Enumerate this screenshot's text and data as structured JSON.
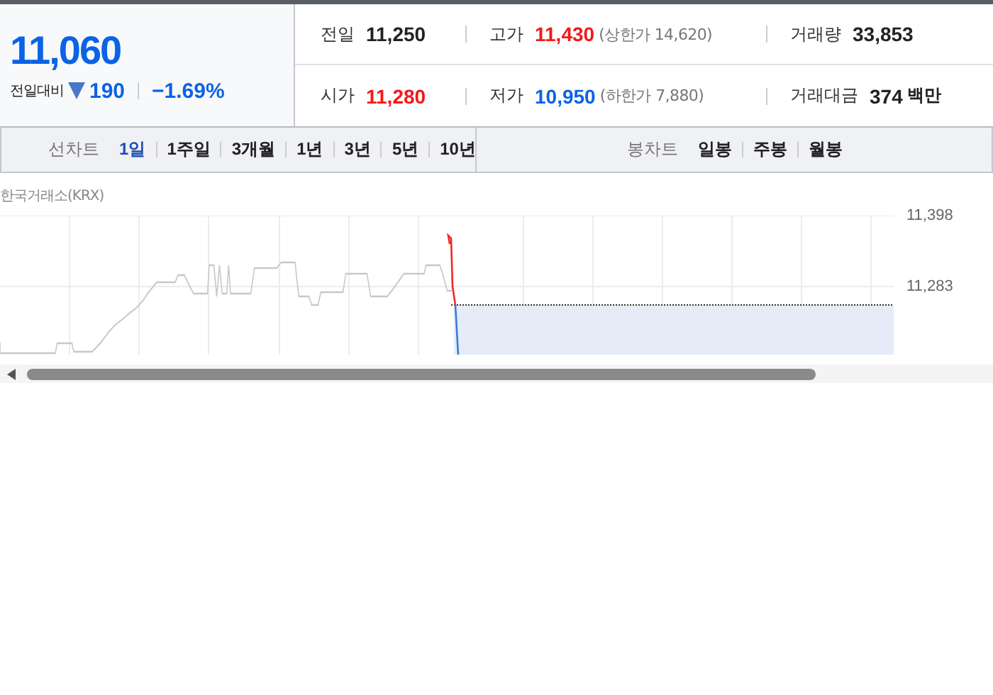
{
  "quote": {
    "price": "11,060",
    "change_label": "전일대비",
    "change": "190",
    "change_rate": "−1.69%"
  },
  "stats": [
    {
      "label": "전일",
      "value": "11,250"
    },
    {
      "label": "고가",
      "value": "11,430",
      "color": "#f51818",
      "note": "(상한가 14,620)"
    },
    {
      "label": "거래량",
      "value": "33,853"
    },
    {
      "label": "시가",
      "value": "11,280",
      "color": "#f51818"
    },
    {
      "label": "저가",
      "value": "10,950",
      "color": "#0b63e5",
      "note": "(하한가 7,880)"
    },
    {
      "label": "거래대금",
      "value": "374",
      "unit": "백만"
    }
  ],
  "line_chart": {
    "label": "선차트",
    "periods": [
      {
        "label": "1일",
        "selected": true
      },
      {
        "label": "1주일",
        "selected": false
      },
      {
        "label": "3개월",
        "selected": false
      },
      {
        "label": "1년",
        "selected": false
      },
      {
        "label": "3년",
        "selected": false
      },
      {
        "label": "5년",
        "selected": false
      },
      {
        "label": "10년",
        "selected": false
      }
    ]
  },
  "candle_chart": {
    "label": "봉차트",
    "periods": [
      {
        "label": "일봉",
        "selected": false
      },
      {
        "label": "주봉",
        "selected": false
      },
      {
        "label": "월봉",
        "selected": false
      }
    ]
  },
  "chart": {
    "exchange": "한국거래소(KRX)",
    "y_labels": [
      "11,398",
      "11,283"
    ]
  }
}
